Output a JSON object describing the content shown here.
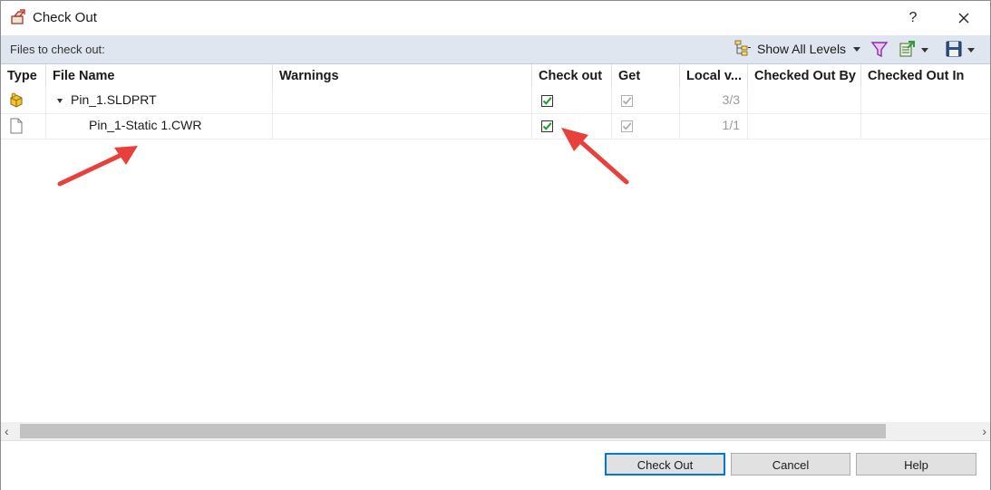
{
  "window": {
    "title": "Check Out",
    "help_label": "?"
  },
  "toolbar": {
    "label": "Files to check out:",
    "show_levels_label": "Show All Levels"
  },
  "columns": [
    "Type",
    "File Name",
    "Warnings",
    "Check out",
    "Get",
    "Local v...",
    "Checked Out By",
    "Checked Out In"
  ],
  "rows": [
    {
      "type_icon": "part-icon",
      "file_name": "Pin_1.SLDPRT",
      "expanded": true,
      "warnings": "",
      "check_out": true,
      "get": true,
      "local_version": "3/3",
      "checked_out_by": "",
      "checked_out_in": ""
    },
    {
      "type_icon": "document-icon",
      "file_name": "Pin_1-Static 1.CWR",
      "expanded": false,
      "warnings": "",
      "check_out": true,
      "get": true,
      "local_version": "1/1",
      "checked_out_by": "",
      "checked_out_in": ""
    }
  ],
  "annotations": {
    "arrow_color": "#e8403a",
    "arrows": [
      "arrow-to-file-name",
      "arrow-to-check-out-checkbox"
    ]
  },
  "buttons": {
    "check_out": "Check Out",
    "cancel": "Cancel",
    "help": "Help"
  },
  "colors": {
    "toolbar_bg": "#dfe6f0",
    "checkbox_check": "#1f9a2e",
    "default_button_border": "#0078d7"
  }
}
